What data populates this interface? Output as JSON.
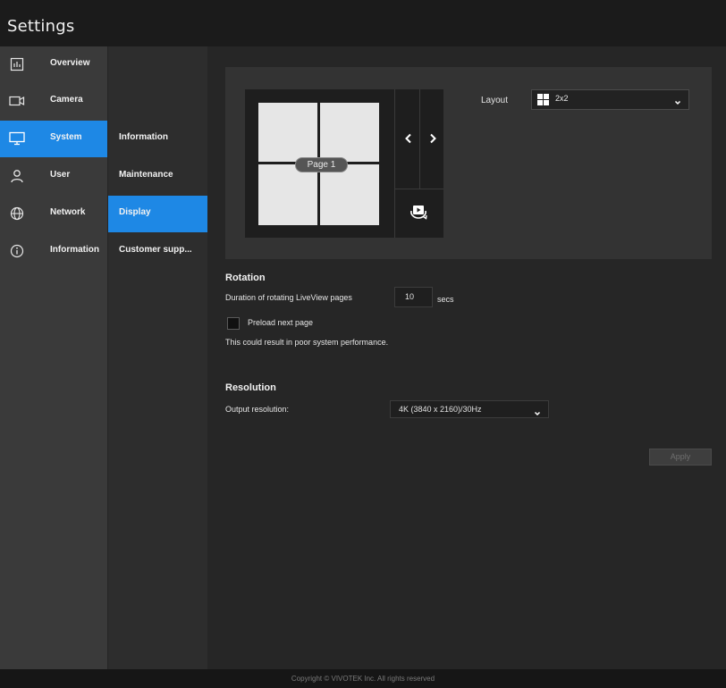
{
  "window": {
    "title": "Settings"
  },
  "sidebar": {
    "items": [
      {
        "label": "Overview",
        "icon": "overview-icon",
        "active": false
      },
      {
        "label": "Camera",
        "icon": "camera-icon",
        "active": false
      },
      {
        "label": "System",
        "icon": "monitor-icon",
        "active": true
      },
      {
        "label": "User",
        "icon": "user-icon",
        "active": false
      },
      {
        "label": "Network",
        "icon": "globe-icon",
        "active": false
      },
      {
        "label": "Information",
        "icon": "info-icon",
        "active": false
      }
    ]
  },
  "subnav": {
    "items": [
      {
        "label": "Information",
        "active": false
      },
      {
        "label": "Maintenance",
        "active": false
      },
      {
        "label": "Display",
        "active": true
      },
      {
        "label": "Customer supp...",
        "active": false
      }
    ]
  },
  "preview": {
    "page_label": "Page 1",
    "prev_icon": "chevron-left-icon",
    "next_icon": "chevron-right-icon",
    "rotate_icon": "rotate-play-icon"
  },
  "layout": {
    "label": "Layout",
    "value": "2x2",
    "icon": "grid-2x2-icon"
  },
  "rotation": {
    "title": "Rotation",
    "duration_label": "Duration of rotating LiveView pages",
    "duration_value": "10",
    "duration_unit": "secs",
    "preload_label": "Preload next page",
    "preload_checked": false,
    "warning": "This could result in poor system performance."
  },
  "resolution": {
    "title": "Resolution",
    "output_label": "Output resolution:",
    "output_value": "4K (3840 x 2160)/30Hz"
  },
  "actions": {
    "apply_label": "Apply"
  },
  "footer": {
    "copyright": "Copyright © VIVOTEK Inc. All rights reserved"
  },
  "colors": {
    "accent": "#1e88e5",
    "background": "#262626",
    "sidebar": "#3a3a3a"
  }
}
